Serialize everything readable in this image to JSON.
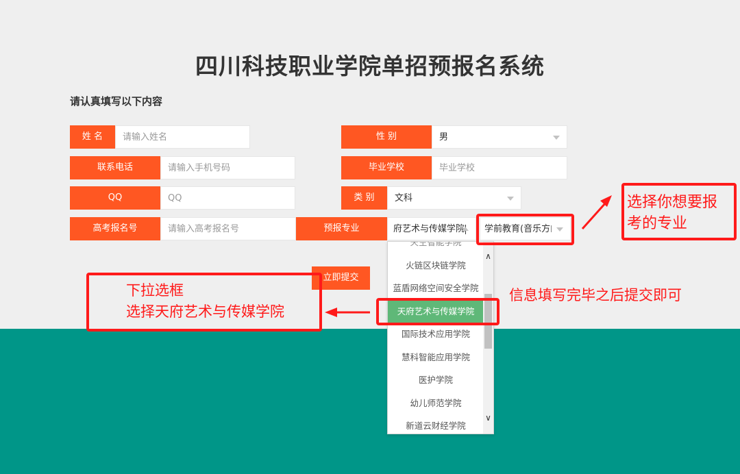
{
  "page": {
    "title": "四川科技职业学院单招预报名系统",
    "subtitle": "请认真填写以下内容"
  },
  "form": {
    "name": {
      "label": "姓 名",
      "placeholder": "请输入姓名"
    },
    "gender": {
      "label": "性 别",
      "value": "男"
    },
    "phone": {
      "label": "联系电话",
      "placeholder": "请输入手机号码"
    },
    "school": {
      "label": "毕业学校",
      "placeholder": "毕业学校"
    },
    "qq": {
      "label": "QQ",
      "placeholder": "QQ"
    },
    "category": {
      "label": "类 别",
      "value": "文科"
    },
    "exam_no": {
      "label": "高考报名号",
      "placeholder": "请输入高考报名号"
    },
    "major": {
      "label": "预报专业",
      "college_value": "府艺术与传媒学院",
      "major_value": "学前教育(音乐方向"
    },
    "submit_label": "立即提交"
  },
  "dropdown": {
    "partial_top": "天空智能学院",
    "items": [
      "火链区块链学院",
      "蓝盾网络空间安全学院",
      "天府艺术与传媒学院",
      "国际技术应用学院",
      "慧科智能应用学院",
      "医护学院",
      "幼儿师范学院",
      "新道云财经学院"
    ],
    "selected_index": 2
  },
  "annotations": {
    "major_hint": [
      "选择你想要报",
      "考的专业"
    ],
    "dropdown_hint": [
      "下拉选框",
      "选择天府艺术与传媒学院"
    ],
    "submit_hint": "信息填写完毕之后提交即可"
  },
  "colors": {
    "accent": "#ff5722",
    "selected": "#5fb878",
    "band": "#009688",
    "annotation": "#ff1a1a"
  }
}
